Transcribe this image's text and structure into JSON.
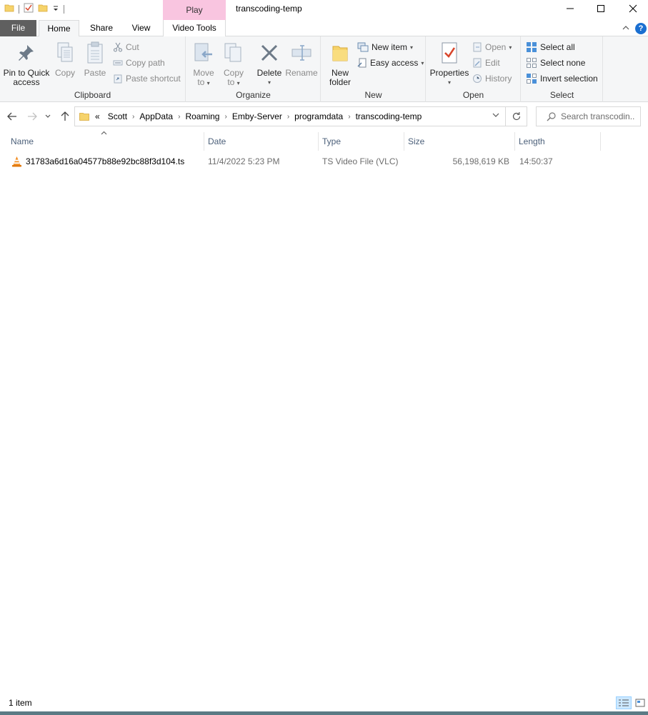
{
  "window": {
    "title": "transcoding-temp",
    "context_tab_header": "Play",
    "controls": {
      "minimize": "—",
      "maximize": "☐",
      "close": "✕"
    }
  },
  "tabs": [
    {
      "label": "File"
    },
    {
      "label": "Home"
    },
    {
      "label": "Share"
    },
    {
      "label": "View"
    },
    {
      "label": "Video Tools"
    }
  ],
  "ribbon": {
    "clipboard": {
      "label": "Clipboard",
      "pin_line1": "Pin to Quick",
      "pin_line2": "access",
      "copy": "Copy",
      "paste": "Paste",
      "cut": "Cut",
      "copy_path": "Copy path",
      "paste_shortcut": "Paste shortcut"
    },
    "organize": {
      "label": "Organize",
      "move_line1": "Move",
      "move_line2": "to",
      "copy_line1": "Copy",
      "copy_line2": "to",
      "delete": "Delete",
      "rename": "Rename"
    },
    "new": {
      "label": "New",
      "folder_line1": "New",
      "folder_line2": "folder",
      "new_item": "New item",
      "easy_access": "Easy access"
    },
    "open": {
      "label": "Open",
      "properties": "Properties",
      "open": "Open",
      "edit": "Edit",
      "history": "History"
    },
    "select": {
      "label": "Select",
      "select_all": "Select all",
      "select_none": "Select none",
      "invert": "Invert selection"
    }
  },
  "address": {
    "overflow": "«",
    "crumbs": [
      "Scott",
      "AppData",
      "Roaming",
      "Emby-Server",
      "programdata",
      "transcoding-temp"
    ],
    "search_placeholder": "Search transcodin..."
  },
  "columns": [
    "Name",
    "Date",
    "Type",
    "Size",
    "Length"
  ],
  "files": [
    {
      "name": "31783a6d16a04577b88e92bc88f3d104.ts",
      "date": "11/4/2022 5:23 PM",
      "type": "TS Video File (VLC)",
      "size": "56,198,619 KB",
      "length": "14:50:37",
      "icon": "vlc-cone-icon"
    }
  ],
  "status": {
    "item_count": "1 item"
  },
  "colors": {
    "file_tab": "#5f5f5f",
    "context_tab": "#f9c5e0",
    "ribbon_bg": "#f5f6f7",
    "header_text": "#4c607a",
    "accent": "#1a6fd1"
  }
}
